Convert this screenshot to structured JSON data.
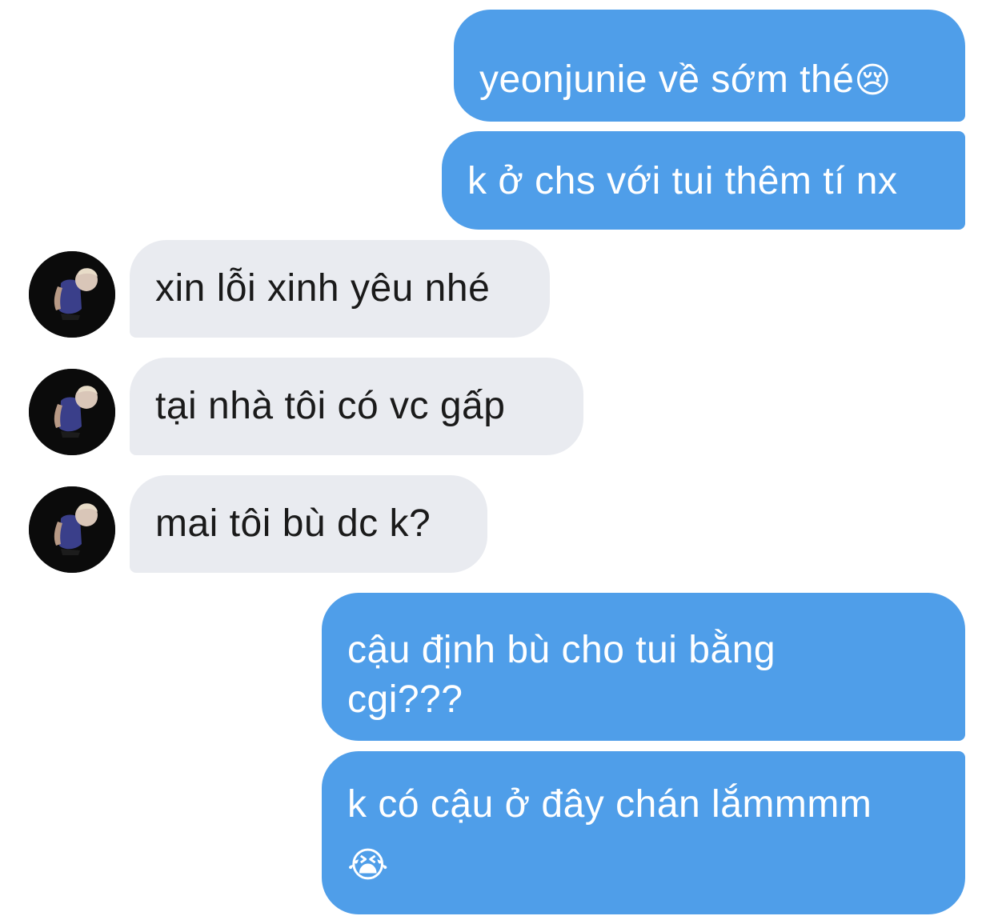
{
  "conversation": {
    "messages": [
      {
        "side": "sent",
        "text": "yeonjunie về sớm thé",
        "emoji": "😢"
      },
      {
        "side": "sent",
        "text": "k ở chs với tui thêm tí nx"
      },
      {
        "side": "received",
        "text": "xin lỗi xinh yêu nhé"
      },
      {
        "side": "received",
        "text": "tại nhà tôi có vc gấp"
      },
      {
        "side": "received",
        "text": "mai tôi bù dc k?"
      },
      {
        "side": "sent",
        "line1": "cậu định bù cho tui bằng",
        "line2": "cgi???"
      },
      {
        "side": "sent",
        "text": "k có cậu ở đây chán lắmmmm",
        "emoji": "😭"
      }
    ]
  },
  "colors": {
    "sent_bubble": "#4f9ee9",
    "received_bubble": "#e9ebf0",
    "sent_text": "#ffffff",
    "received_text": "#1a1a1a",
    "background": "#ffffff"
  },
  "icons": {
    "avatar": "profile-photo"
  }
}
